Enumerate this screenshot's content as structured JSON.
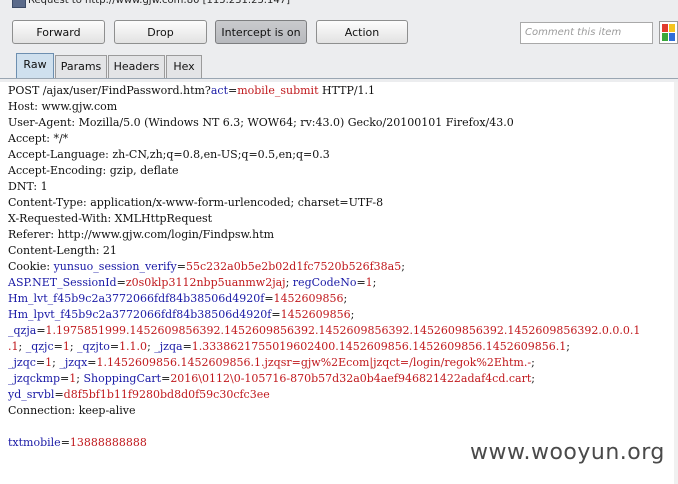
{
  "window": {
    "title": "Request to http://www.gjw.com:80  [115.231.25.147]"
  },
  "toolbar": {
    "forward_label": "Forward",
    "drop_label": "Drop",
    "intercept_label": "Intercept is on",
    "action_label": "Action",
    "comment_placeholder": "Comment this item"
  },
  "tabs": [
    {
      "label": "Raw",
      "selected": true
    },
    {
      "label": "Params",
      "selected": false
    },
    {
      "label": "Headers",
      "selected": false
    },
    {
      "label": "Hex",
      "selected": false
    }
  ],
  "request": {
    "l0a": "POST /ajax/user/FindPassword.htm?",
    "l0b": "act",
    "l0c": "=",
    "l0d": "mobile_submit",
    "l0e": " HTTP/1.1",
    "l1": "Host: www.gjw.com",
    "l2": "User-Agent: Mozilla/5.0 (Windows NT 6.3; WOW64; rv:43.0) Gecko/20100101 Firefox/43.0",
    "l3": "Accept: */*",
    "l4": "Accept-Language: zh-CN,zh;q=0.8,en-US;q=0.5,en;q=0.3",
    "l5": "Accept-Encoding: gzip, deflate",
    "l6": "DNT: 1",
    "l7": "Content-Type: application/x-www-form-urlencoded; charset=UTF-8",
    "l8": "X-Requested-With: XMLHttpRequest",
    "l9": "Referer: http://www.gjw.com/login/Findpsw.htm",
    "l10": "Content-Length: 21",
    "c1a": "Cookie: ",
    "c1b": "yunsuo_session_verify",
    "c1c": "=",
    "c1d": "55c232a0b5e2b02d1fc7520b526f38a5",
    "c1e": ";",
    "c2a": "ASP.NET_SessionId",
    "c2b": "=",
    "c2c": "z0s0klp3112nbp5uanmw2jaj",
    "c2d": "; ",
    "c2e": "regCodeNo",
    "c2f": "=",
    "c2g": "1",
    "c2h": ";",
    "c3a": "Hm_lvt_f45b9c2a3772066fdf84b38506d4920f",
    "c3b": "=",
    "c3c": "1452609856",
    "c3d": ";",
    "c4a": "Hm_lpvt_f45b9c2a3772066fdf84b38506d4920f",
    "c4b": "=",
    "c4c": "1452609856",
    "c4d": ";",
    "c5a": "_qzja",
    "c5b": "=",
    "c5c": "1.1975851999.1452609856392.1452609856392.1452609856392.1452609856392.1452609856392.0.0.0.1",
    "c6a": ".1",
    "c6b": "; ",
    "c6c": "_qzjc",
    "c6d": "=",
    "c6e": "1",
    "c6f": "; ",
    "c6g": "_qzjto",
    "c6h": "=",
    "c6i": "1.1.0",
    "c6j": "; ",
    "c6k": "_jzqa",
    "c6l": "=",
    "c6m": "1.3338621755019602400.1452609856.1452609856.1452609856.1",
    "c6n": ";",
    "c7a": "_jzqc",
    "c7b": "=",
    "c7c": "1",
    "c7d": "; ",
    "c7e": "_jzqx",
    "c7f": "=",
    "c7g": "1.1452609856.1452609856.1.jzqsr=gjw%2Ecom|jzqct=/login/regok%2Ehtm.-",
    "c7h": ";",
    "c8a": "_jzqckmp",
    "c8b": "=",
    "c8c": "1",
    "c8d": "; ",
    "c8e": "ShoppingCart",
    "c8f": "=",
    "c8g": "2016\\0112\\0-105716-870b57d32a0b4aef946821422adaf4cd.cart",
    "c8h": ";",
    "c9a": "yd_srvbl",
    "c9b": "=",
    "c9c": "d8f5bf1b11f9280bd8d0f59c30cfc3ee",
    "l20": "Connection: keep-alive",
    "b1a": "txtmobile",
    "b1b": "=",
    "b1c": "13888888888"
  },
  "watermark": "www.wooyun.org",
  "colors": {
    "param_name": "#1a1aa6",
    "param_value": "#c0191d",
    "toolbar_bg": "#ecedef",
    "tab_selected": "#cfe0ee"
  }
}
